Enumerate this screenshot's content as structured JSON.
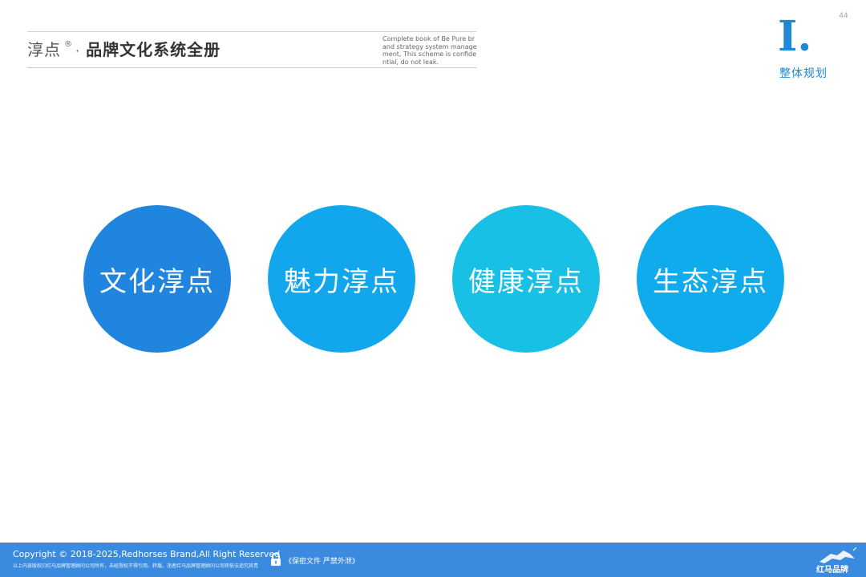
{
  "page_number": "44",
  "header": {
    "brand_name": "淳点",
    "registered_mark": "®",
    "separator": "·",
    "subtitle": "品牌文化系统全册",
    "note": "Complete book of Be Pure brand strategy system management, This scheme is confidential, do not leak."
  },
  "section": {
    "numeral": "I.",
    "title": "整体规划"
  },
  "circles": [
    {
      "label": "文化淳点",
      "color": "#1f85df"
    },
    {
      "label": "魅力淳点",
      "color": "#12a7ec"
    },
    {
      "label": "健康淳点",
      "color": "#19c0e5"
    },
    {
      "label": "生态淳点",
      "color": "#10abec"
    }
  ],
  "footer": {
    "copyright": "Copyright © 2018-2025,Redhorses Brand,All Right Reserved",
    "rights_notice": "以上内容版权归红马品牌管理顾问公司所有，未经授权不得引用、转载，违者红马品牌管理顾问公司将依法追究其责",
    "confidential_label": "《保密文件 严禁外泄》",
    "lock_icon": "lock-icon",
    "logo_text": "红马品牌",
    "footer_color": "#3a8be0"
  }
}
